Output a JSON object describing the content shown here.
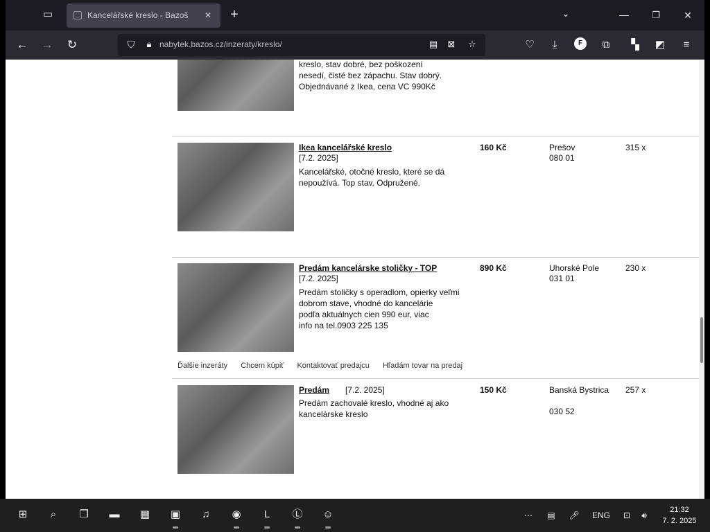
{
  "tabstrip": {
    "tab_title": "Kancelářské kreslo - Bazoš",
    "tab_close": "✕",
    "new_tab": "+"
  },
  "navbar": {
    "back": "←",
    "forward": "→",
    "reload": "↻",
    "url": "nabytek.bazos.cz/inzeraty/kreslo/"
  },
  "listings": [
    {
      "title": "",
      "desc_lines": [
        "kreslo, stav dobré, bez poškození",
        "nesedí, čisté bez zápachu. Stav dobrý.",
        "Objednávané z Ikea, cena VC 990Kč"
      ],
      "price": "",
      "location": [
        "",
        ""
      ],
      "views": ""
    },
    {
      "title": "Ikea kancelářské kreslo",
      "date": "[7.2. 2025]",
      "desc_lines": [
        "Kancelářské, otočné kreslo, které se dá",
        "nepoužívá. Top stav. Odpružené."
      ],
      "price": "160 Kč",
      "location": [
        "Prešov",
        "080 01"
      ],
      "views": "315 x"
    },
    {
      "title": "Predám kancelárske stoličky  - TOP",
      "date": "[7.2. 2025]",
      "desc_lines": [
        "Predám stoličky s operadlom, opierky veľmi",
        "dobrom stave, vhodné do kancelárie",
        "podľa aktuálnych cien 990 eur, viac",
        "info na tel.0903 225 135"
      ],
      "price": "890 Kč",
      "location": [
        "Uhorské Pole",
        "031 01"
      ],
      "views": "230 x"
    },
    {
      "title": "Predám",
      "date": "[7.2. 2025]",
      "desc_lines": [
        "Predám zachovalé kreslo, vhodné aj ako",
        "kancelárske kreslo"
      ],
      "price": "150 Kč",
      "location": [
        "Banská Bystrica",
        "030 52"
      ],
      "views": "257 x"
    }
  ],
  "extras": [
    "Ďalšie inzeráty",
    "Chcem kúpiť",
    "Kontaktovať predajcu",
    "Hľadám tovar na predaj"
  ],
  "taskbar": {
    "lang": "ENG",
    "time": "21:32",
    "date": "7. 2. 2025"
  },
  "icons": {
    "tab_list": "tab-list-icon",
    "tracking_shield": "shield-icon",
    "lock": "lock-icon",
    "reader": "reader-view-icon",
    "translate": "translate-icon",
    "bookmark": "star-icon",
    "pocket": "pocket-icon",
    "downloads": "download-icon",
    "profile": "profile-icon",
    "extensions": "extensions-icon",
    "menu": "hamburger-icon"
  }
}
